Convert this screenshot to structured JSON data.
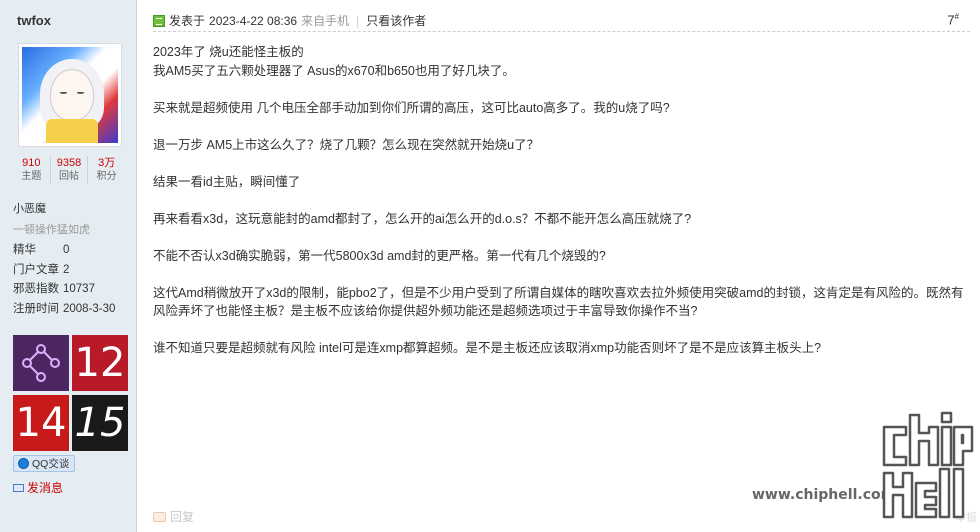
{
  "user": {
    "name": "twfox",
    "stats": [
      {
        "value": "910",
        "label": "主题"
      },
      {
        "value": "9358",
        "label": "回帖"
      },
      {
        "value": "3万",
        "label": "积分"
      }
    ],
    "rank": "小恶魔",
    "rank_title": "一顿操作猛如虎",
    "info": [
      {
        "key": "精华",
        "value": "0"
      },
      {
        "key": "门户文章",
        "value": "2"
      },
      {
        "key": "邪恶指数",
        "value": "10737"
      },
      {
        "key": "注册时间",
        "value": "2008-3-30"
      }
    ],
    "medals": [
      "",
      "12",
      "14",
      "15"
    ],
    "qq_label": "QQ交谈",
    "message_label": "发消息"
  },
  "post": {
    "posted_prefix": "发表于",
    "datetime": "2023-4-22 08:36",
    "source": "来自手机",
    "author_only": "只看该作者",
    "floor": "7",
    "floor_suffix": "#",
    "paragraphs": [
      [
        "2023年了 烧u还能怪主板的",
        "我AM5买了五六颗处理器了 Asus的x670和b650也用了好几块了。"
      ],
      [
        "买来就是超频使用 几个电压全部手动加到你们所谓的高压，这可比auto高多了。我的u烧了吗?"
      ],
      [
        "退一万步 AM5上市这么久了？烧了几颗？怎么现在突然就开始烧u了？"
      ],
      [
        "结果一看id主贴，瞬间懂了"
      ],
      [
        "再来看看x3d，这玩意能封的amd都封了，怎么开的ai怎么开的d.o.s？不都不能开怎么高压就烧了?"
      ],
      [
        "不能不否认x3d确实脆弱，第一代5800x3d amd封的更严格。第一代有几个烧毁的?"
      ],
      [
        "这代Amd稍微放开了x3d的限制，能pbo2了，但是不少用户受到了所谓自媒体的瞎吹喜欢去拉外频使用突破amd的封锁，这肯定是有风险的。既然有",
        "风险弄坏了也能怪主板？是主板不应该给你提供超外频功能还是超频选项过于丰富导致你操作不当?"
      ],
      [
        "谁不知道只要是超频就有风险 intel可是连xmp都算超频。是不是主板还应该取消xmp功能否则坏了是不是应该算主板头上?"
      ]
    ],
    "reply_label": "回复",
    "report_label": "举报"
  },
  "watermark": {
    "url": "www.chiphell.com"
  }
}
